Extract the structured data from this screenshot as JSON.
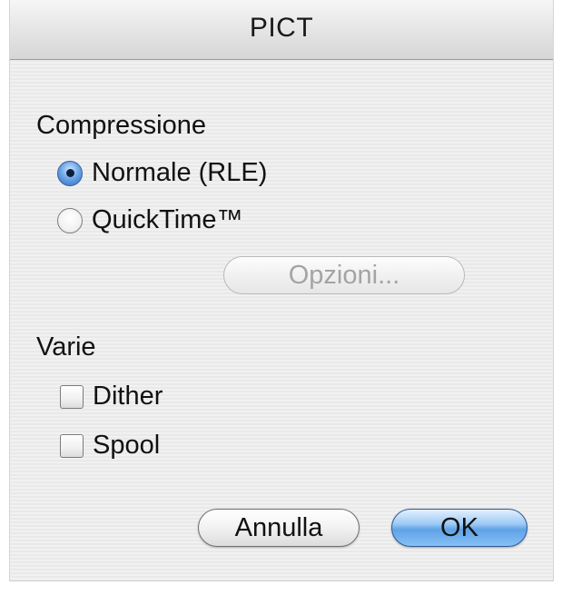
{
  "window": {
    "title": "PICT"
  },
  "compression": {
    "label": "Compressione",
    "options": [
      {
        "label": "Normale (RLE)",
        "selected": true
      },
      {
        "label": "QuickTime™",
        "selected": false
      }
    ],
    "options_button": "Opzioni..."
  },
  "misc": {
    "label": "Varie",
    "checkboxes": [
      {
        "label": "Dither",
        "checked": false
      },
      {
        "label": "Spool",
        "checked": false
      }
    ]
  },
  "buttons": {
    "cancel": "Annulla",
    "ok": "OK"
  },
  "colors": {
    "default_button": "#7fb6ee",
    "selected_radio": "#2c6bc4"
  },
  "icons": {
    "radio_selected": "radio-selected",
    "radio_unselected": "radio-unselected",
    "checkbox_unchecked": "checkbox-unchecked"
  }
}
